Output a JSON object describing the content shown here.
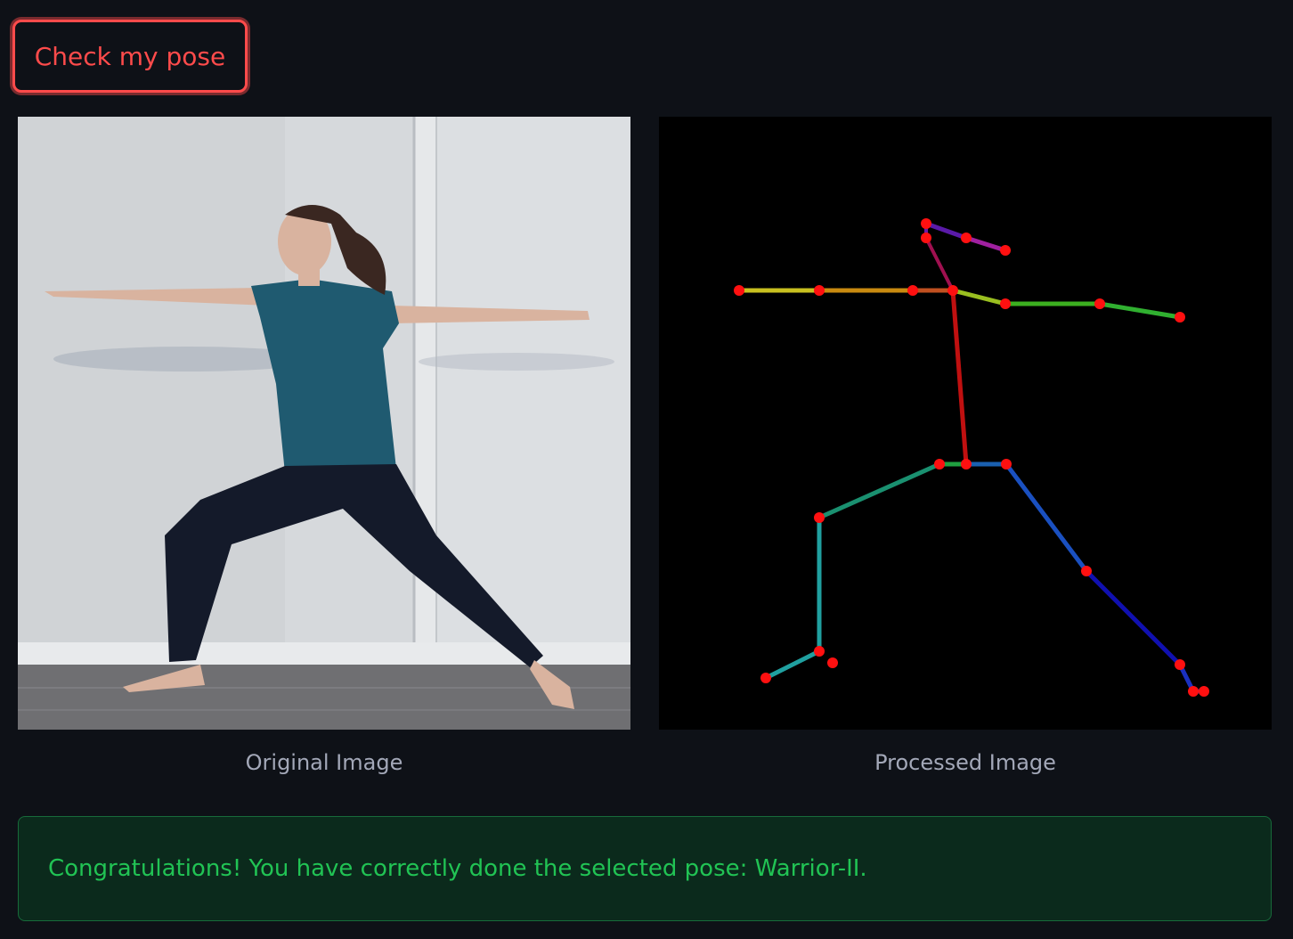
{
  "actions": {
    "check_label": "Check my pose"
  },
  "images": {
    "original_caption": "Original Image",
    "processed_caption": "Processed Image"
  },
  "result": {
    "message": "Congratulations! You have correctly done the selected pose: Warrior-II."
  },
  "colors": {
    "background": "#0e1117",
    "button_accent": "#ff4b4b",
    "success_text": "#21c354",
    "success_bg": "#0b2a1c",
    "caption_text": "#a3a8b8"
  }
}
